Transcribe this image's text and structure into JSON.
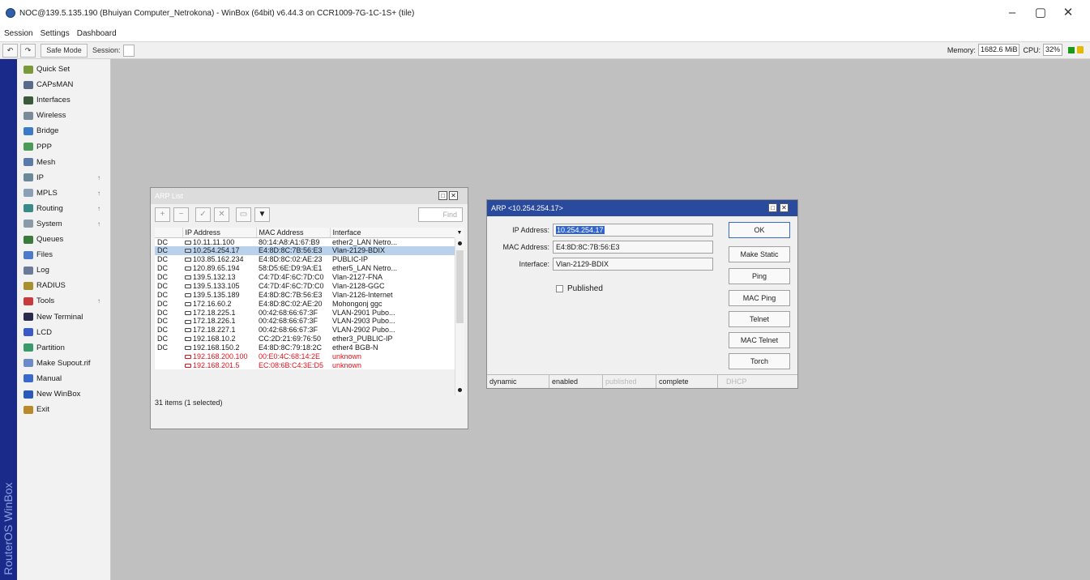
{
  "window": {
    "title": "NOC@139.5.135.190 (Bhuiyan Computer_Netrokona) - WinBox (64bit) v6.44.3 on CCR1009-7G-1C-1S+ (tile)",
    "minimize": "–",
    "maximize": "▢",
    "close": "✕"
  },
  "menu": [
    "Session",
    "Settings",
    "Dashboard"
  ],
  "toolbar": {
    "undo": "↶",
    "redo": "↷",
    "safe_mode": "Safe Mode",
    "session_label": "Session:",
    "memory_label": "Memory:",
    "memory_value": "1682.6 MiB",
    "cpu_label": "CPU:",
    "cpu_value": "32%"
  },
  "brand": "RouterOS WinBox",
  "sidebar": {
    "items": [
      {
        "label": "Quick Set",
        "icon": "quick-set-icon",
        "color": "#7a9a3a",
        "arrow": ""
      },
      {
        "label": "CAPsMAN",
        "icon": "capsman-icon",
        "color": "#5a6a8a",
        "arrow": ""
      },
      {
        "label": "Interfaces",
        "icon": "interfaces-icon",
        "color": "#3a5a3a",
        "arrow": ""
      },
      {
        "label": "Wireless",
        "icon": "wireless-icon",
        "color": "#7a8a9a",
        "arrow": ""
      },
      {
        "label": "Bridge",
        "icon": "bridge-icon",
        "color": "#3a7ac9",
        "arrow": ""
      },
      {
        "label": "PPP",
        "icon": "ppp-icon",
        "color": "#4a9a5a",
        "arrow": ""
      },
      {
        "label": "Mesh",
        "icon": "mesh-icon",
        "color": "#5a7aa9",
        "arrow": ""
      },
      {
        "label": "IP",
        "icon": "ip-icon",
        "color": "#6a8a9a",
        "arrow": "↑"
      },
      {
        "label": "MPLS",
        "icon": "mpls-icon",
        "color": "#8aa0b8",
        "arrow": "↑"
      },
      {
        "label": "Routing",
        "icon": "routing-icon",
        "color": "#3a8a8a",
        "arrow": "↑"
      },
      {
        "label": "System",
        "icon": "system-icon",
        "color": "#8a9aa8",
        "arrow": "↑"
      },
      {
        "label": "Queues",
        "icon": "queues-icon",
        "color": "#3a7a3a",
        "arrow": ""
      },
      {
        "label": "Files",
        "icon": "files-icon",
        "color": "#4a7ac9",
        "arrow": ""
      },
      {
        "label": "Log",
        "icon": "log-icon",
        "color": "#6a7a9a",
        "arrow": ""
      },
      {
        "label": "RADIUS",
        "icon": "radius-icon",
        "color": "#a89030",
        "arrow": ""
      },
      {
        "label": "Tools",
        "icon": "tools-icon",
        "color": "#c93a3a",
        "arrow": "↑"
      },
      {
        "label": "New Terminal",
        "icon": "terminal-icon",
        "color": "#2a2a4a",
        "arrow": ""
      },
      {
        "label": "LCD",
        "icon": "lcd-icon",
        "color": "#3a5ac9",
        "arrow": ""
      },
      {
        "label": "Partition",
        "icon": "partition-icon",
        "color": "#3a9a6a",
        "arrow": ""
      },
      {
        "label": "Make Supout.rif",
        "icon": "supout-icon",
        "color": "#6a8ac9",
        "arrow": ""
      },
      {
        "label": "Manual",
        "icon": "manual-icon",
        "color": "#3a6ac9",
        "arrow": ""
      },
      {
        "label": "New WinBox",
        "icon": "winbox-icon",
        "color": "#2a5ab9",
        "arrow": ""
      },
      {
        "label": "Exit",
        "icon": "exit-icon",
        "color": "#b98a2a",
        "arrow": ""
      }
    ]
  },
  "arp_list": {
    "title": "ARP List",
    "find_placeholder": "Find",
    "tools": [
      "+",
      "−",
      "✓",
      "✕",
      "▭",
      "▼"
    ],
    "columns": [
      "",
      "IP Address",
      "MAC Address",
      "Interface"
    ],
    "rows": [
      {
        "flags": "DC",
        "ip": "10.11.11.100",
        "mac": "80:14:A8:A1:67:B9",
        "iface": "ether2_LAN Netro...",
        "selected": false,
        "red": false
      },
      {
        "flags": "DC",
        "ip": "10.254.254.17",
        "mac": "E4:8D:8C:7B:56:E3",
        "iface": "Vlan-2129-BDIX",
        "selected": true,
        "red": false
      },
      {
        "flags": "DC",
        "ip": "103.85.162.234",
        "mac": "E4:8D:8C:02:AE:23",
        "iface": "PUBLIC-IP",
        "selected": false,
        "red": false
      },
      {
        "flags": "DC",
        "ip": "120.89.65.194",
        "mac": "58:D5:6E:D9:9A:E1",
        "iface": "ether5_LAN Netro...",
        "selected": false,
        "red": false
      },
      {
        "flags": "DC",
        "ip": "139.5.132.13",
        "mac": "C4:7D:4F:6C:7D:C0",
        "iface": "Vlan-2127-FNA",
        "selected": false,
        "red": false
      },
      {
        "flags": "DC",
        "ip": "139.5.133.105",
        "mac": "C4:7D:4F:6C:7D:C0",
        "iface": "Vlan-2128-GGC",
        "selected": false,
        "red": false
      },
      {
        "flags": "DC",
        "ip": "139.5.135.189",
        "mac": "E4:8D:8C:7B:56:E3",
        "iface": "Vlan-2126-Internet",
        "selected": false,
        "red": false
      },
      {
        "flags": "DC",
        "ip": "172.16.60.2",
        "mac": "E4:8D:8C:02:AE:20",
        "iface": "Mohongonj ggc",
        "selected": false,
        "red": false
      },
      {
        "flags": "DC",
        "ip": "172.18.225.1",
        "mac": "00:42:68:66:67:3F",
        "iface": "VLAN-2901 Pubo...",
        "selected": false,
        "red": false
      },
      {
        "flags": "DC",
        "ip": "172.18.226.1",
        "mac": "00:42:68:66:67:3F",
        "iface": "VLAN-2903 Pubo...",
        "selected": false,
        "red": false
      },
      {
        "flags": "DC",
        "ip": "172.18.227.1",
        "mac": "00:42:68:66:67:3F",
        "iface": "VLAN-2902 Pubo...",
        "selected": false,
        "red": false
      },
      {
        "flags": "DC",
        "ip": "192.168.10.2",
        "mac": "CC:2D:21:69:76:50",
        "iface": "ether3_PUBLIC-IP",
        "selected": false,
        "red": false
      },
      {
        "flags": "DC",
        "ip": "192.168.150.2",
        "mac": "E4:8D:8C:79:18:2C",
        "iface": "ether4 BGB-N",
        "selected": false,
        "red": false
      },
      {
        "flags": "",
        "ip": "192.168.200.100",
        "mac": "00:E0:4C:68:14:2E",
        "iface": "unknown",
        "selected": false,
        "red": true
      },
      {
        "flags": "",
        "ip": "192.168.201.5",
        "mac": "EC:08:6B:C4:3E:D5",
        "iface": "unknown",
        "selected": false,
        "red": true
      }
    ],
    "status": "31 items (1 selected)"
  },
  "arp_detail": {
    "title": "ARP <10.254.254.17>",
    "ip_label": "IP Address:",
    "ip_value": "10.254.254.17",
    "mac_label": "MAC Address:",
    "mac_value": "E4:8D:8C:7B:56:E3",
    "iface_label": "Interface:",
    "iface_value": "Vlan-2129-BDIX",
    "published_label": "Published",
    "buttons": {
      "ok": "OK",
      "make_static": "Make Static",
      "ping": "Ping",
      "mac_ping": "MAC Ping",
      "telnet": "Telnet",
      "mac_telnet": "MAC Telnet",
      "torch": "Torch"
    },
    "status": [
      "dynamic",
      "enabled",
      "published",
      "complete",
      "DHCP"
    ]
  },
  "colors": {
    "desktop": "#c0c0c0",
    "stripe": "#1a2a8a",
    "active_title": "#2a4a9e",
    "selection": "#b9d1ea",
    "error_text": "#e0101a"
  }
}
